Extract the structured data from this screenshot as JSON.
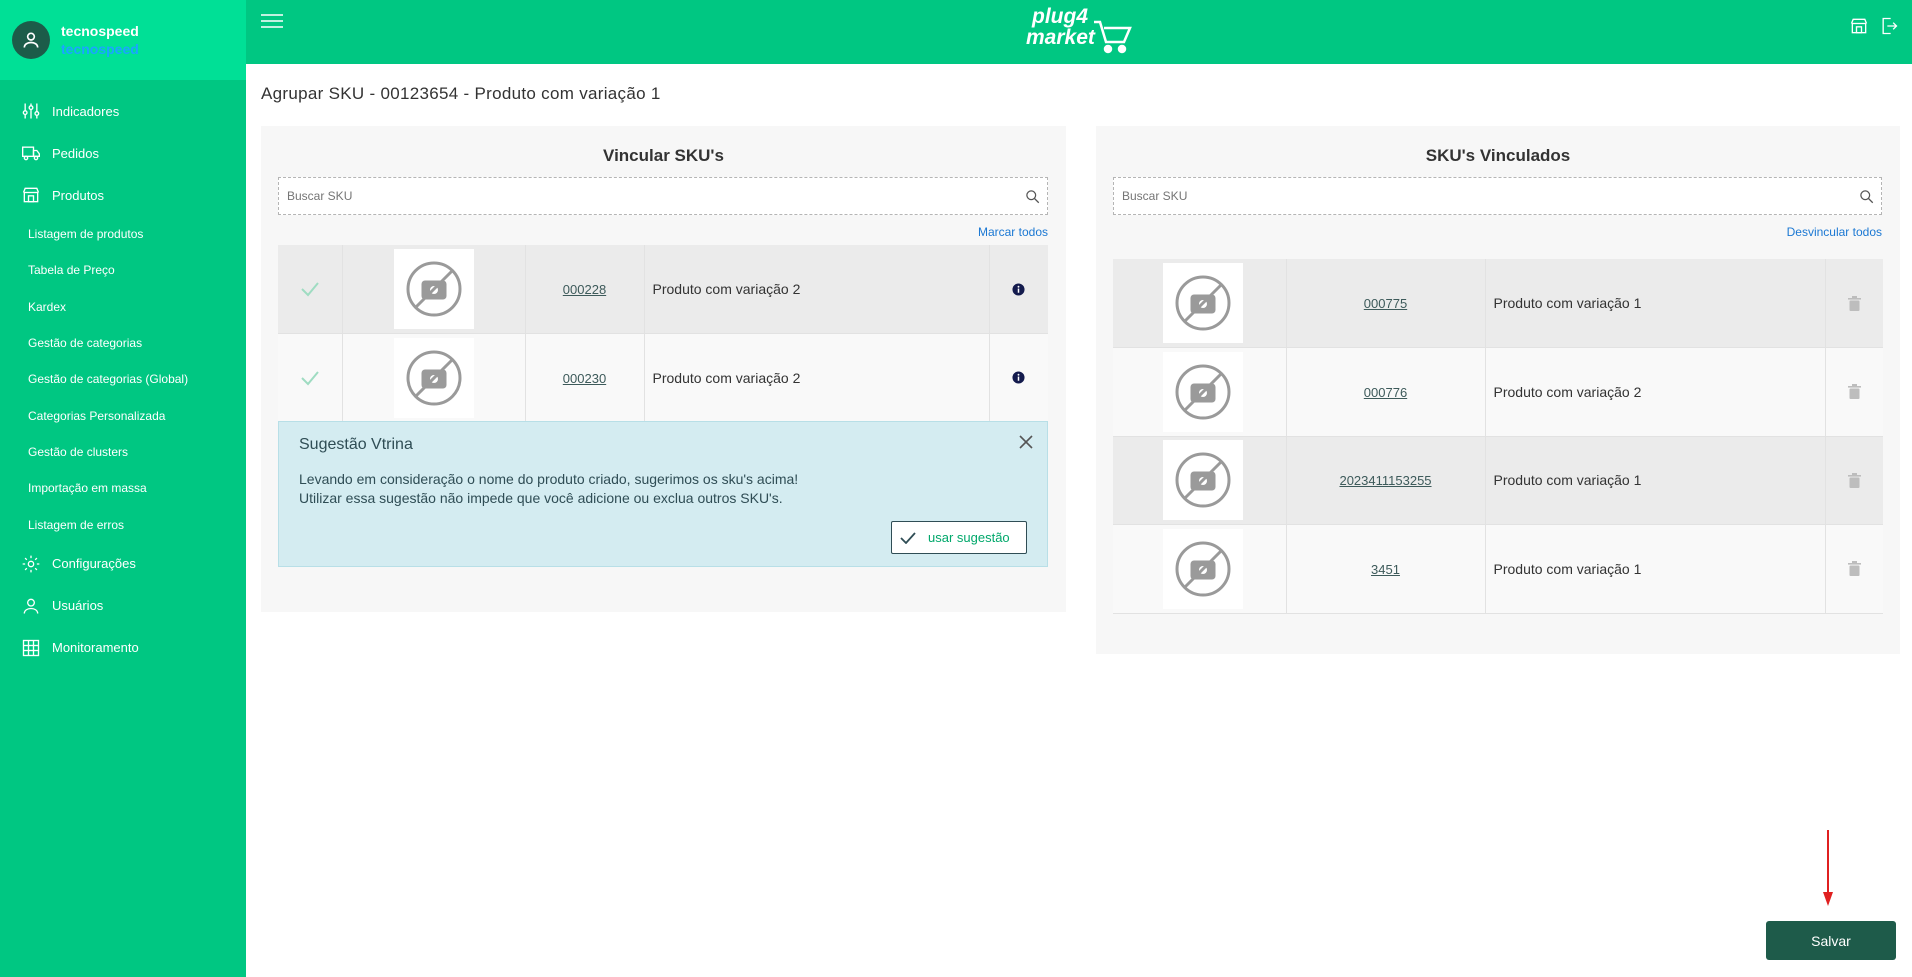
{
  "user": {
    "name": "tecnospeed",
    "company": "tecnospeed"
  },
  "sidebar": {
    "items": [
      {
        "label": "Indicadores",
        "icon": "sliders-icon"
      },
      {
        "label": "Pedidos",
        "icon": "truck-icon"
      },
      {
        "label": "Produtos",
        "icon": "store-icon"
      }
    ],
    "submenu": [
      "Listagem de produtos",
      "Tabela de Preço",
      "Kardex",
      "Gestão de categorias",
      "Gestão de categorias (Global)",
      "Categorias Personalizada",
      "Gestão de clusters",
      "Importação em massa",
      "Listagem de erros"
    ],
    "bottom_items": [
      {
        "label": "Configurações",
        "icon": "gear-icon"
      },
      {
        "label": "Usuários",
        "icon": "user-icon"
      },
      {
        "label": "Monitoramento",
        "icon": "monitor-grid-icon"
      }
    ]
  },
  "topbar": {
    "logo_line1": "plug4",
    "logo_line2": "market"
  },
  "page": {
    "title": "Agrupar SKU - 00123654 - Produto com variação 1"
  },
  "left_panel": {
    "title": "Vincular SKU's",
    "search_placeholder": "Buscar SKU",
    "action": "Marcar todos",
    "rows": [
      {
        "sku": "000228",
        "name": "Produto com variação 2"
      },
      {
        "sku": "000230",
        "name": "Produto com variação 2"
      }
    ]
  },
  "right_panel": {
    "title": "SKU's Vinculados",
    "search_placeholder": "Buscar SKU",
    "action": "Desvincular todos",
    "rows": [
      {
        "sku": "000775",
        "name": "Produto com variação 1"
      },
      {
        "sku": "000776",
        "name": "Produto com variação 2"
      },
      {
        "sku": "2023411153255",
        "name": "Produto com variação 1"
      },
      {
        "sku": "3451",
        "name": "Produto com variação 1"
      }
    ]
  },
  "alert": {
    "title": "Sugestão Vtrina",
    "line1": "Levando em consideração o nome do produto criado, sugerimos os sku's acima!",
    "line2": "Utilizar essa sugestão não impede que você adicione ou exclua outros SKU's.",
    "button": "usar sugestão"
  },
  "save_label": "Salvar",
  "colors": {
    "primary": "#00c782",
    "header": "#00e096",
    "dark": "#1e5b4a",
    "link": "#1b78d3",
    "arrow": "#e02020"
  }
}
